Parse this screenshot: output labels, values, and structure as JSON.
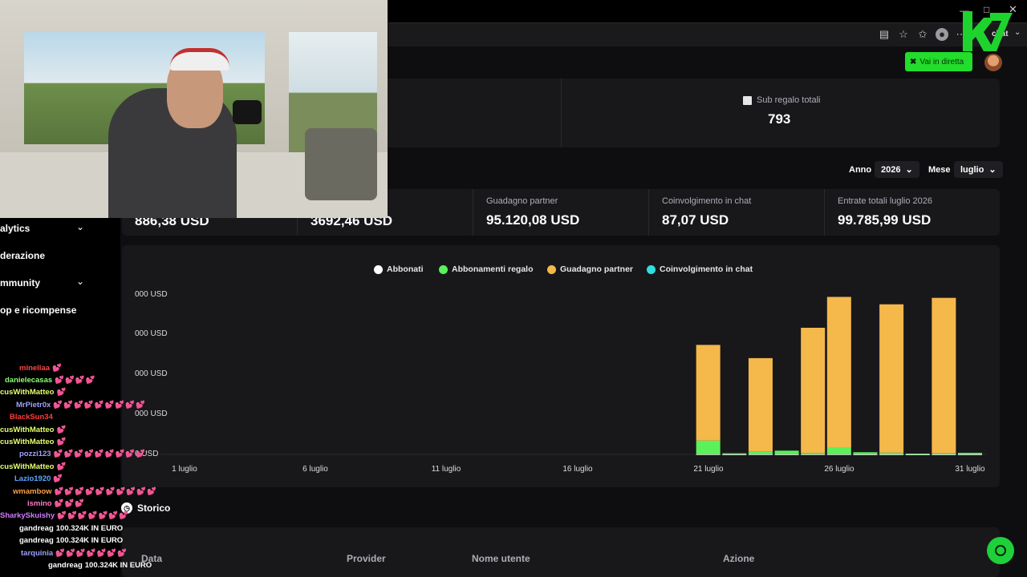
{
  "header": {
    "go_live_label": "Vai in diretta",
    "chat_label": "chat"
  },
  "stats_top": {
    "label": "Sub regalo totali",
    "value": "793"
  },
  "filters": {
    "year_label": "Anno",
    "year_value": "2026",
    "month_label": "Mese",
    "month_value": "luglio"
  },
  "stats": [
    {
      "label": "",
      "value": "886,38 USD"
    },
    {
      "label": "",
      "value": "3692,46 USD"
    },
    {
      "label": "Guadagno partner",
      "value": "95.120,08 USD"
    },
    {
      "label": "Coinvolgimento in chat",
      "value": "87,07 USD"
    },
    {
      "label": "Entrate totali luglio 2026",
      "value": "99.785,99 USD"
    }
  ],
  "chart_data": {
    "type": "bar",
    "stacked": true,
    "legend": [
      "Abbonati",
      "Abbonamenti regalo",
      "Guadagno partner",
      "Coinvolgimento in chat"
    ],
    "series_colors": [
      "#ffffff",
      "#5af15a",
      "#f5b84a",
      "#2fe0e0"
    ],
    "yticks": [
      "000 USD",
      "000 USD",
      "000 USD",
      "000 USD",
      "0 USD"
    ],
    "xticks": [
      "1 luglio",
      "6 luglio",
      "11 luglio",
      "16 luglio",
      "21 luglio",
      "26 luglio",
      "31 luglio"
    ],
    "ylim": [
      0,
      20000
    ],
    "days": [
      21,
      22,
      23,
      24,
      25,
      26,
      27,
      28,
      29,
      30,
      31
    ],
    "series": [
      {
        "name": "Abbonati",
        "values": [
          30,
          20,
          30,
          20,
          30,
          30,
          20,
          20,
          20,
          20,
          20
        ]
      },
      {
        "name": "Abbonamenti regalo",
        "values": [
          1700,
          120,
          340,
          450,
          150,
          820,
          250,
          200,
          80,
          110,
          180
        ]
      },
      {
        "name": "Guadagno partner",
        "values": [
          12000,
          0,
          11700,
          0,
          15700,
          18900,
          0,
          18600,
          0,
          19500,
          0
        ]
      },
      {
        "name": "Coinvolgimento in chat",
        "values": [
          0,
          0,
          0,
          0,
          0,
          0,
          0,
          0,
          0,
          0,
          0
        ]
      }
    ]
  },
  "sidebar": {
    "items": [
      "alytics",
      "derazione",
      "mmunity",
      "op e ricompense"
    ]
  },
  "chat": [
    {
      "user": "minellaa",
      "color": "#ff4545",
      "hearts": "💕",
      "msg": ""
    },
    {
      "user": "danielecasas",
      "color": "#8dff7a",
      "hearts": "💕💕💕💕",
      "msg": ""
    },
    {
      "user": "cusWithMatteo",
      "color": "#e5ff6f",
      "hearts": "💕",
      "msg": ""
    },
    {
      "user": "MrPietr0x",
      "color": "#9fa0ff",
      "hearts": "💕💕💕💕💕💕💕💕💕",
      "msg": ""
    },
    {
      "user": "BlackSun34",
      "color": "#ff3c3c",
      "hearts": "",
      "msg": ""
    },
    {
      "user": "cusWithMatteo",
      "color": "#e5ff6f",
      "hearts": "💕",
      "msg": ""
    },
    {
      "user": "cusWithMatteo",
      "color": "#e5ff6f",
      "hearts": "💕",
      "msg": ""
    },
    {
      "user": "pozzi123",
      "color": "#9fa0ff",
      "hearts": "💕💕💕💕💕💕💕💕💕",
      "msg": ""
    },
    {
      "user": "cusWithMatteo",
      "color": "#e5ff6f",
      "hearts": "💕",
      "msg": ""
    },
    {
      "user": "Lazio1920",
      "color": "#5aa7ff",
      "hearts": "💕",
      "msg": ""
    },
    {
      "user": "wmambow",
      "color": "#ff9f4a",
      "hearts": "💕💕💕💕💕💕💕💕💕💕",
      "msg": ""
    },
    {
      "user": "ismino",
      "color": "#ff79c9",
      "hearts": "💕💕💕",
      "msg": ""
    },
    {
      "user": "SharkySkuishy",
      "color": "#d07bff",
      "hearts": "💕💕💕💕💕💕💕",
      "msg": ""
    },
    {
      "user": "gandreag",
      "color": "#ffffff",
      "hearts": "",
      "msg": "100.324K IN EURO"
    },
    {
      "user": "gandreag",
      "color": "#ffffff",
      "hearts": "",
      "msg": "100.324K IN EURO"
    },
    {
      "user": "tarquinia",
      "color": "#9fa0ff",
      "hearts": "💕💕💕💕💕💕💕",
      "msg": ""
    },
    {
      "user": "gandreag",
      "color": "#ffffff",
      "hearts": "",
      "msg": "100.324K IN EURO"
    }
  ],
  "history": {
    "title": "Storico",
    "columns": [
      "Data",
      "Provider",
      "Nome utente",
      "Azione"
    ]
  }
}
